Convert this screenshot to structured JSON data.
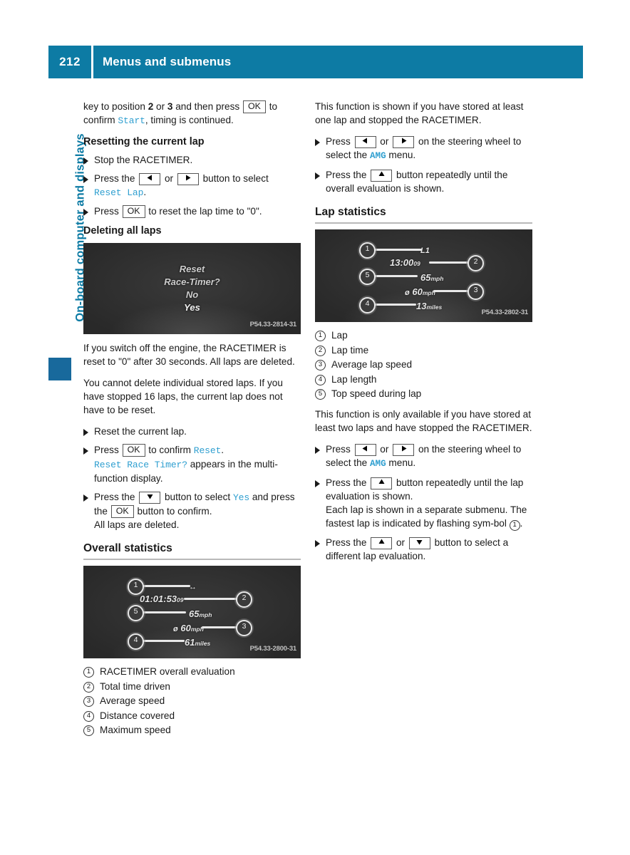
{
  "header": {
    "page_number": "212",
    "title": "Menus and submenus"
  },
  "side_tab": {
    "label": "On-board computer and displays"
  },
  "left_column": {
    "intro": {
      "t1": "key to position ",
      "b1": "2",
      "t2": " or ",
      "b2": "3",
      "t3": " and then press ",
      "key_ok": "OK",
      "t4": " to confirm ",
      "code_start": "Start",
      "t5": ", timing is continued."
    },
    "heading_reset_lap": "Resetting the current lap",
    "steps_reset_lap": {
      "s1": "Stop the RACETIMER.",
      "s2_a": "Press the ",
      "s2_or": " or ",
      "s2_b": " button to select ",
      "s2_code": "Reset Lap",
      "s2_end": ".",
      "s3_a": "Press ",
      "s3_key": "OK",
      "s3_b": " to reset the lap time to \"0\"."
    },
    "heading_deleting": "Deleting all laps",
    "screen_reset": {
      "line1": "Reset",
      "line2": "Race-Timer?",
      "line3": "No",
      "line4": "Yes",
      "code": "P54.33-2814-31"
    },
    "para1": "If you switch off the engine, the RACETIMER is reset to \"0\" after 30 seconds. All laps are deleted.",
    "para2": "You cannot delete individual stored laps. If you have stopped 16 laps, the current lap does not have to be reset.",
    "steps_delete": {
      "s1": "Reset the current lap.",
      "s2_a": "Press ",
      "s2_key": "OK",
      "s2_b": " to confirm ",
      "s2_code": "Reset",
      "s2_c": ".",
      "s2_cont_code": "Reset Race Timer?",
      "s2_cont": " appears in the multi-function display.",
      "s3_a": "Press the ",
      "s3_b": " button to select ",
      "s3_code": "Yes",
      "s3_c": " and press the ",
      "s3_key": "OK",
      "s3_d": " button to confirm.",
      "s3_cont": "All laps are deleted."
    },
    "heading_overall": "Overall statistics",
    "screen_overall": {
      "code": "P54.33-2800-31",
      "v_top": "↔",
      "v_time": "01:01:53",
      "v_time_unit": "09",
      "v_max": "65",
      "v_max_unit": "mph",
      "v_avg_prefix": "ø",
      "v_avg": "60",
      "v_avg_unit": "mph",
      "v_dist": "61",
      "v_dist_unit": "miles",
      "b1": "1",
      "b2": "2",
      "b3": "3",
      "b4": "4",
      "b5": "5"
    },
    "legend_overall": [
      {
        "num": "1",
        "text": "RACETIMER overall evaluation"
      },
      {
        "num": "2",
        "text": "Total time driven"
      },
      {
        "num": "3",
        "text": "Average speed"
      },
      {
        "num": "4",
        "text": "Distance covered"
      },
      {
        "num": "5",
        "text": "Maximum speed"
      }
    ]
  },
  "right_column": {
    "para1": "This function is shown if you have stored at least one lap and stopped the RACETIMER.",
    "steps_overall": {
      "s1_a": "Press ",
      "s1_or": " or ",
      "s1_b": " on the steering wheel to select the ",
      "s1_code": "AMG",
      "s1_c": " menu.",
      "s2_a": "Press the ",
      "s2_b": " button repeatedly until the overall evaluation is shown."
    },
    "heading_lap_statistics": "Lap statistics",
    "screen_lap": {
      "code": "P54.33-2802-31",
      "v_top": "L1",
      "v_time": "13:00",
      "v_time_unit": "09",
      "v_max": "65",
      "v_max_unit": "mph",
      "v_avg_prefix": "ø",
      "v_avg": "60",
      "v_avg_unit": "mph",
      "v_dist": "13",
      "v_dist_unit": "miles",
      "b1": "1",
      "b2": "2",
      "b3": "3",
      "b4": "4",
      "b5": "5"
    },
    "legend_lap": [
      {
        "num": "1",
        "text": "Lap"
      },
      {
        "num": "2",
        "text": "Lap time"
      },
      {
        "num": "3",
        "text": "Average lap speed"
      },
      {
        "num": "4",
        "text": "Lap length"
      },
      {
        "num": "5",
        "text": "Top speed during lap"
      }
    ],
    "para2": "This function is only available if you have stored at least two laps and have stopped the RACETIMER.",
    "steps_lap": {
      "s1_a": "Press ",
      "s1_or": " or ",
      "s1_b": " on the steering wheel to select the ",
      "s1_code": "AMG",
      "s1_c": " menu.",
      "s2_a": "Press the ",
      "s2_b": " button repeatedly until the lap evaluation is shown.",
      "s2_cont1": "Each lap is shown in a separate submenu. The fastest lap is indicated by flashing sym-bol ",
      "s2_cont_num": "1",
      "s2_cont2": ".",
      "s3_a": "Press the ",
      "s3_or": " or ",
      "s3_b": " button to select a different lap evaluation."
    }
  },
  "colors": {
    "accent": "#0d7ba4",
    "code_blue": "#2f9fd0",
    "rule": "#b9b9b9"
  }
}
